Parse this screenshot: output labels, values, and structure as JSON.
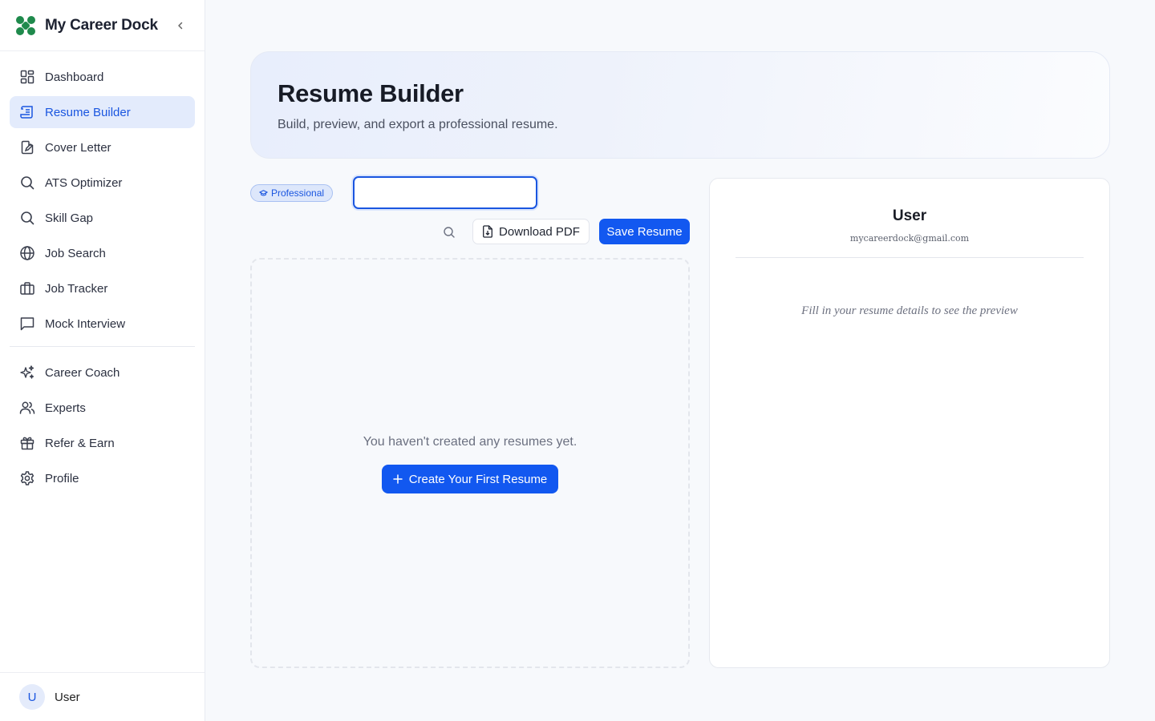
{
  "sidebar": {
    "app_name": "My Career Dock",
    "items": [
      {
        "label": "Dashboard",
        "icon": "dashboard-icon"
      },
      {
        "label": "Resume Builder",
        "icon": "resume-icon",
        "active": true
      },
      {
        "label": "Cover Letter",
        "icon": "cover-letter-icon"
      },
      {
        "label": "ATS Optimizer",
        "icon": "search-icon"
      },
      {
        "label": "Skill Gap",
        "icon": "search-icon"
      },
      {
        "label": "Job Search",
        "icon": "globe-icon"
      },
      {
        "label": "Job Tracker",
        "icon": "briefcase-icon"
      },
      {
        "label": "Mock Interview",
        "icon": "chat-icon"
      }
    ],
    "items_secondary": [
      {
        "label": "Career Coach",
        "icon": "sparkles-icon"
      },
      {
        "label": "Experts",
        "icon": "users-icon"
      },
      {
        "label": "Refer & Earn",
        "icon": "gift-icon"
      },
      {
        "label": "Profile",
        "icon": "gear-icon"
      }
    ],
    "footer": {
      "avatar_initial": "U",
      "user_name": "User"
    }
  },
  "header": {
    "title": "Resume Builder",
    "subtitle": "Build, preview, and export a professional resume."
  },
  "toolbar": {
    "template_badge": "Professional",
    "resume_name_value": "",
    "download_label": "Download PDF",
    "save_label": "Save Resume"
  },
  "empty_state": {
    "message": "You haven't created any resumes yet.",
    "create_label": "Create Your First Resume"
  },
  "preview": {
    "name": "User",
    "email": "mycareerdock@gmail.com",
    "hint": "Fill in your resume details to see the preview"
  },
  "colors": {
    "accent": "#1258f0",
    "active_bg": "#e3ebfc",
    "logo_green": "#1f8a4c"
  }
}
